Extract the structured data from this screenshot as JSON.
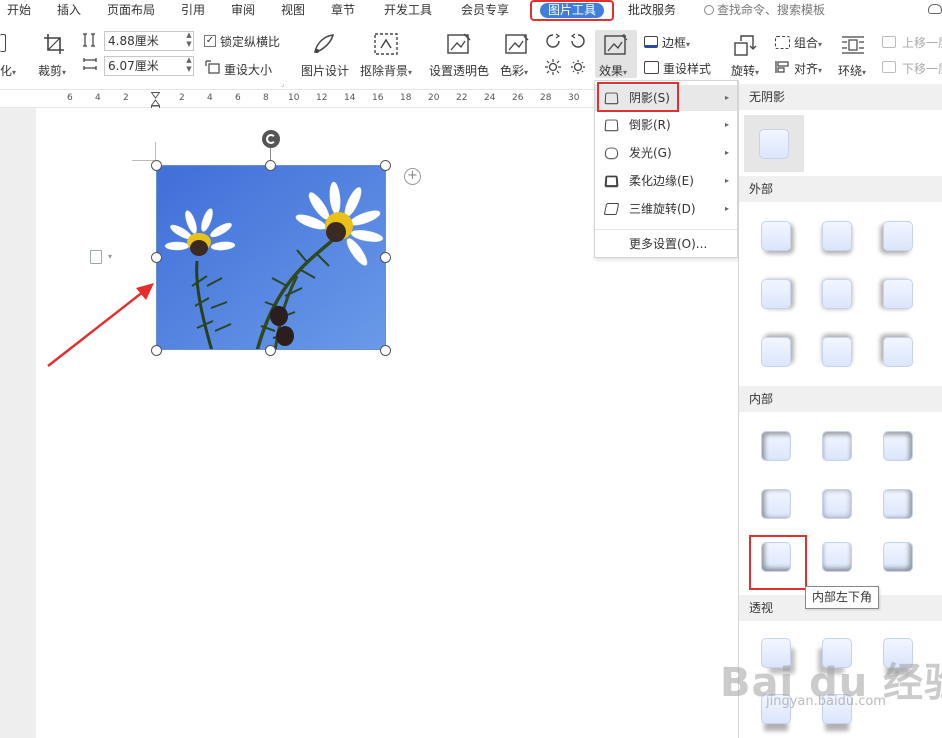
{
  "menu": {
    "items": [
      "开始",
      "插入",
      "页面布局",
      "引用",
      "审阅",
      "视图",
      "章节",
      "开发工具",
      "会员专享"
    ],
    "active_tab": "图片工具",
    "after_active": "批改服务",
    "search_placeholder": "查找命令、搜索模板"
  },
  "ribbon": {
    "left_cut": "化",
    "crop_label": "裁剪",
    "width_value": "4.88厘米",
    "height_value": "6.07厘米",
    "lock_ratio_label": "锁定纵横比",
    "lock_ratio_checked": true,
    "reset_size_label": "重设大小",
    "picture_design_label": "图片设计",
    "remove_bg_label": "抠除背景",
    "set_transparent_label": "设置透明色",
    "color_label": "色彩",
    "effect_label": "效果",
    "border_label": "边框",
    "reset_style_label": "重设样式",
    "rotate_label": "旋转",
    "group_label": "组合",
    "align_label": "对齐",
    "wrap_label": "环绕",
    "bring_forward_label": "上移一层",
    "send_backward_label": "下移一层"
  },
  "ruler": {
    "ticks": [
      "6",
      "4",
      "2",
      "2",
      "4",
      "6",
      "8",
      "10",
      "12",
      "14",
      "16",
      "18",
      "20",
      "22",
      "24",
      "26",
      "28",
      "30"
    ]
  },
  "effect_menu": {
    "items": [
      {
        "label": "阴影(S)",
        "has_submenu": true,
        "highlighted": true
      },
      {
        "label": "倒影(R)",
        "has_submenu": true
      },
      {
        "label": "发光(G)",
        "has_submenu": true
      },
      {
        "label": "柔化边缘(E)",
        "has_submenu": true
      },
      {
        "label": "三维旋转(D)",
        "has_submenu": true
      }
    ],
    "more_settings": "更多设置(O)..."
  },
  "shadow_gallery": {
    "no_shadow_header": "无阴影",
    "outer_header": "外部",
    "inner_header": "内部",
    "perspective_header": "透视",
    "tooltip": "内部左下角"
  },
  "watermark": {
    "main": "Bai du 经验",
    "sub": "jingyan.baidu.com"
  },
  "colors": {
    "accent_blue": "#3f7fd9",
    "highlight_red": "#e03030",
    "sky_blue": "#4a7fe0"
  }
}
